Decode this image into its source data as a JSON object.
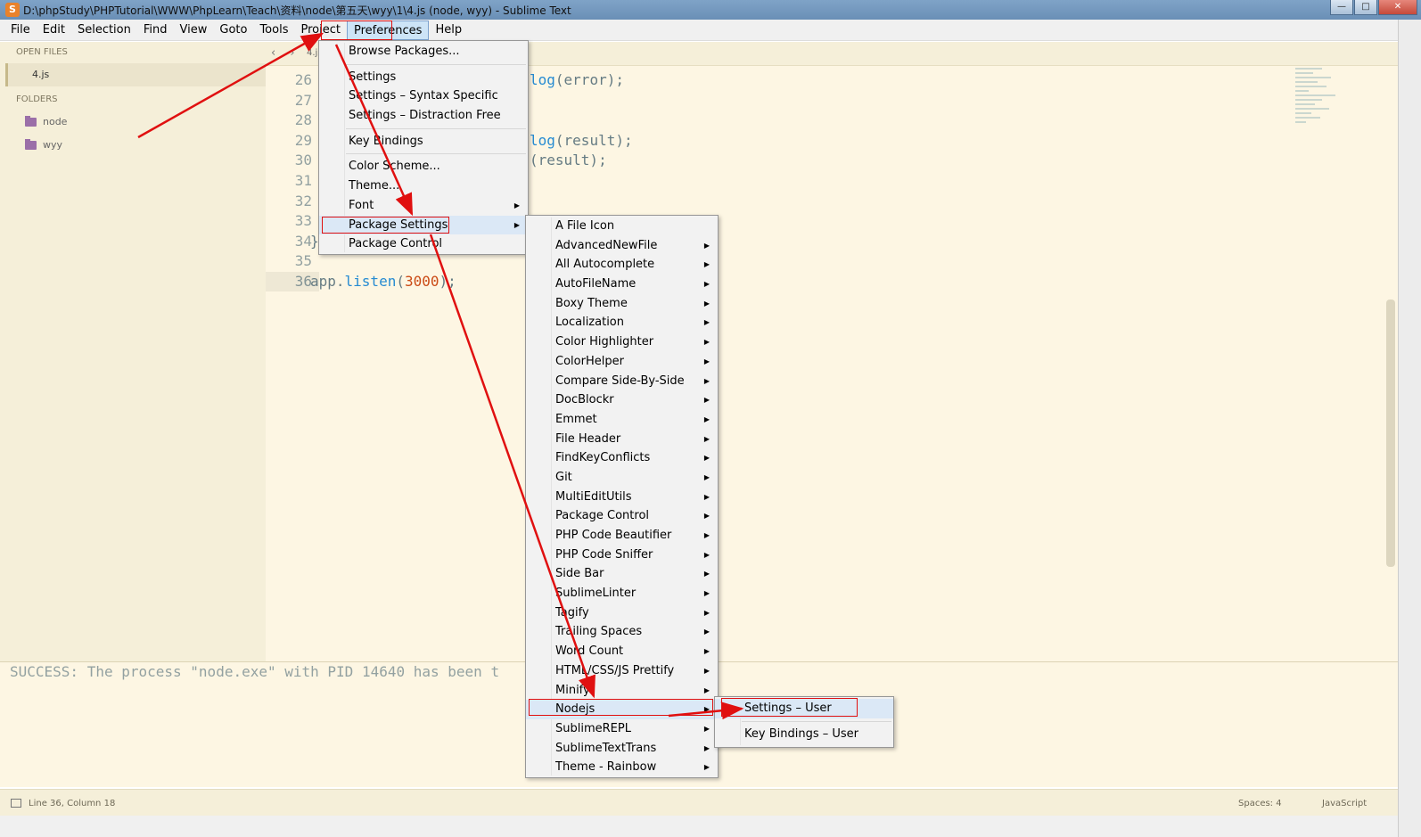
{
  "window": {
    "title": "D:\\phpStudy\\PHPTutorial\\WWW\\PhpLearn\\Teach\\资料\\node\\第五天\\wyy\\1\\4.js (node, wyy) - Sublime Text",
    "icon_label": "S",
    "controls": {
      "minimize": "—",
      "maximize": "□",
      "close": "✕"
    }
  },
  "menubar": [
    "File",
    "Edit",
    "Selection",
    "Find",
    "View",
    "Goto",
    "Tools",
    "Project",
    "Preferences",
    "Help"
  ],
  "sidebar": {
    "open_files_header": "OPEN FILES",
    "open_files": [
      "4.js"
    ],
    "folders_header": "FOLDERS",
    "folders": [
      "node",
      "wyy"
    ]
  },
  "tabs": {
    "nav": "‹ ›",
    "active": "4.js",
    "chevron": "⌄"
  },
  "editor": {
    "lines": [
      {
        "num": "26",
        "code": "log(error);"
      },
      {
        "num": "27",
        "code": ""
      },
      {
        "num": "28",
        "code": ""
      },
      {
        "num": "29",
        "code": "log(result);"
      },
      {
        "num": "30",
        "code": "(result);"
      },
      {
        "num": "31",
        "code": ""
      },
      {
        "num": "32",
        "code": ""
      },
      {
        "num": "33",
        "code": ""
      },
      {
        "num": "34",
        "code": "}"
      },
      {
        "num": "35",
        "code": ""
      },
      {
        "num": "36",
        "code": "app.listen(3000);"
      }
    ],
    "current_line": "36"
  },
  "output": "SUCCESS: The process \"node.exe\" with PID 14640 has been t",
  "statusbar": {
    "position": "Line 36, Column 18",
    "spaces": "Spaces: 4",
    "syntax": "JavaScript"
  },
  "preferences_menu": {
    "items": [
      {
        "label": "Browse Packages...",
        "arrow": ""
      },
      {
        "sep": true
      },
      {
        "label": "Settings",
        "arrow": ""
      },
      {
        "label": "Settings – Syntax Specific",
        "arrow": ""
      },
      {
        "label": "Settings – Distraction Free",
        "arrow": ""
      },
      {
        "sep": true
      },
      {
        "label": "Key Bindings",
        "arrow": ""
      },
      {
        "sep": true
      },
      {
        "label": "Color Scheme...",
        "arrow": ""
      },
      {
        "label": "Theme...",
        "arrow": ""
      },
      {
        "label": "Font",
        "arrow": "▶"
      },
      {
        "label": "Package Settings",
        "arrow": "▶",
        "highlight": true
      },
      {
        "label": "Package Control",
        "arrow": ""
      }
    ]
  },
  "package_settings_menu": {
    "items": [
      "A File Icon",
      "AdvancedNewFile",
      "All Autocomplete",
      "AutoFileName",
      "Boxy Theme",
      "Localization",
      "Color Highlighter",
      "ColorHelper",
      "Compare Side-By-Side",
      "DocBlockr",
      "Emmet",
      "File Header",
      "FindKeyConflicts",
      "Git",
      "MultiEditUtils",
      "Package Control",
      "PHP Code Beautifier",
      "PHP Code Sniffer",
      "Side Bar",
      "SublimeLinter",
      "Tagify",
      "Trailing Spaces",
      "Word Count",
      "HTML/CSS/JS Prettify",
      "Minify",
      "Nodejs",
      "SublimeREPL",
      "SublimeTextTrans",
      "Theme - Rainbow"
    ],
    "arrows_from_index": 1,
    "highlight": "Nodejs",
    "arrow_glyph": "▶"
  },
  "nodejs_submenu": {
    "items": [
      "Settings – User",
      "Key Bindings – User"
    ]
  },
  "annotation_color": "#e01010"
}
